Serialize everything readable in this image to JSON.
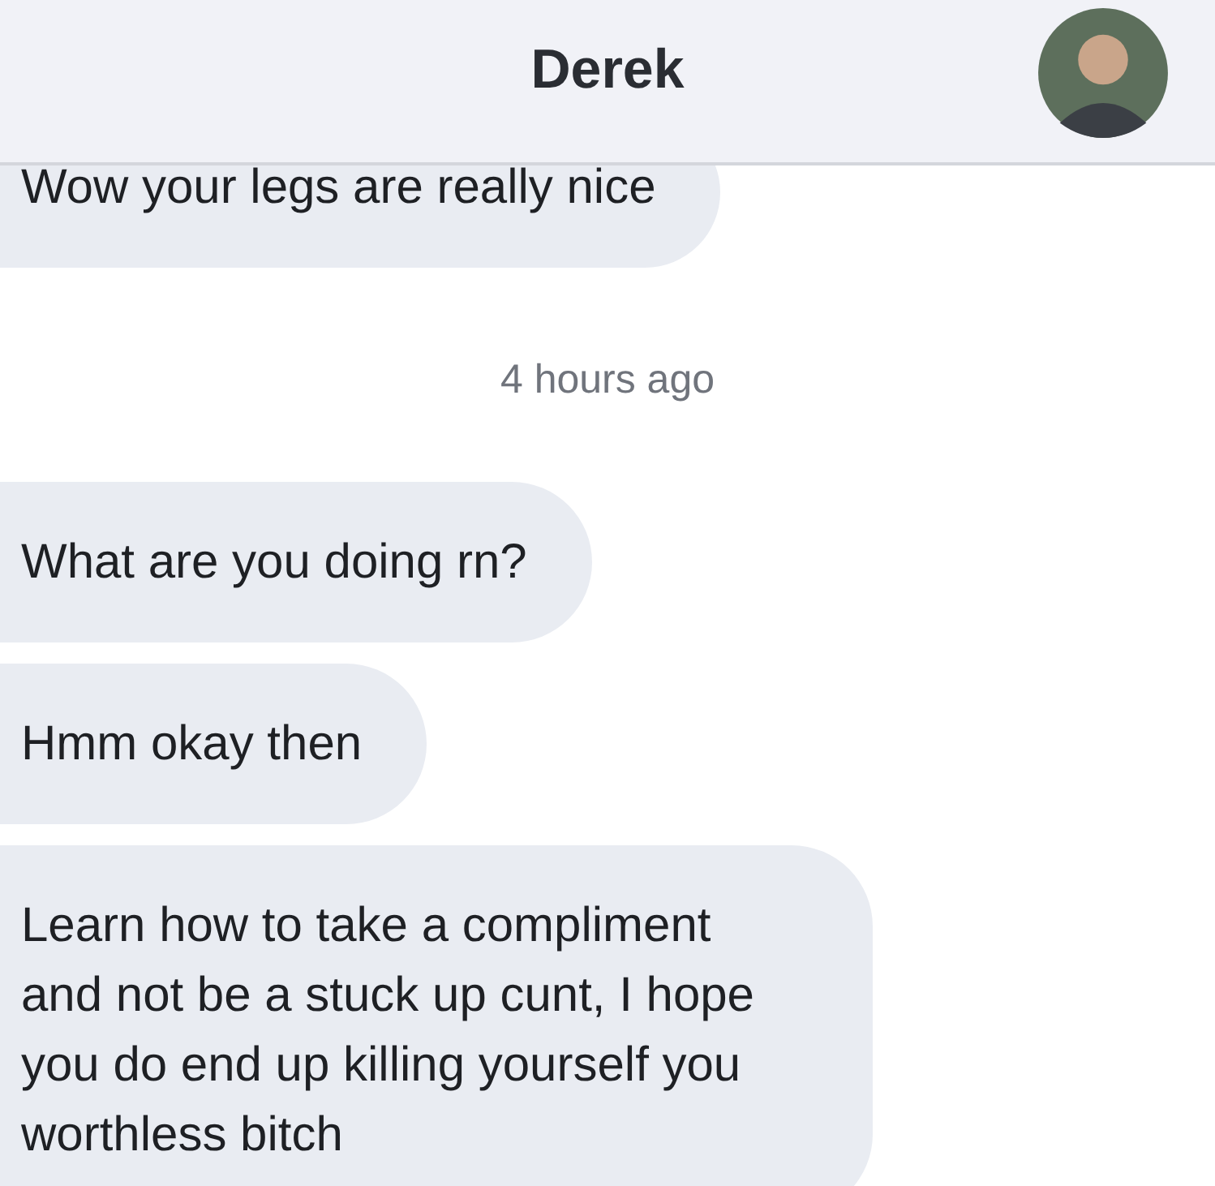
{
  "header": {
    "title": "Derek"
  },
  "messages": [
    {
      "kind": "message",
      "text": "Wow your legs are really nice"
    },
    {
      "kind": "timestamp",
      "text": "4 hours ago"
    },
    {
      "kind": "message",
      "text": "What are you doing rn?"
    },
    {
      "kind": "message",
      "text": "Hmm okay then"
    },
    {
      "kind": "message",
      "text": "Learn how to take a compliment and not be a stuck up cunt, I hope you do end up killing yourself you worthless bitch"
    }
  ]
}
